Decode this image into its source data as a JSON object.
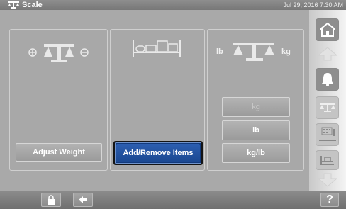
{
  "header": {
    "title": "Scale",
    "datetime": "Jul 29, 2016 7:30 AM"
  },
  "panels": {
    "adjust": {
      "button_label": "Adjust Weight"
    },
    "items": {
      "button_label": "Add/Remove Items"
    },
    "units": {
      "label_lb": "lb",
      "label_kg": "kg",
      "options": [
        "kg",
        "lb",
        "kg/lb"
      ]
    }
  },
  "sidebar": {
    "icons": [
      "home-icon",
      "up-arrow-icon",
      "alarm-bell-icon",
      "scale-icon",
      "bed-exit-icon",
      "egress-icon",
      "down-arrow-icon"
    ]
  },
  "footer": {
    "help_label": "?"
  },
  "colors": {
    "accent": "#1b4891",
    "panel": "#a8a8a8",
    "bar": "#777777"
  }
}
